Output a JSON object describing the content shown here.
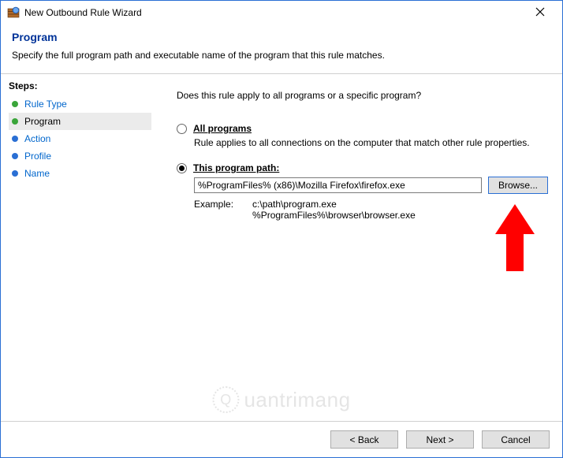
{
  "window": {
    "title": "New Outbound Rule Wizard"
  },
  "header": {
    "title": "Program",
    "subtitle": "Specify the full program path and executable name of the program that this rule matches."
  },
  "sidebar": {
    "title": "Steps:",
    "items": [
      {
        "label": "Rule Type"
      },
      {
        "label": "Program"
      },
      {
        "label": "Action"
      },
      {
        "label": "Profile"
      },
      {
        "label": "Name"
      }
    ]
  },
  "content": {
    "prompt": "Does this rule apply to all programs or a specific program?",
    "all_programs": {
      "label": "All programs",
      "desc": "Rule applies to all connections on the computer that match other rule properties."
    },
    "this_path": {
      "label": "This program path:",
      "value": "%ProgramFiles% (x86)\\Mozilla Firefox\\firefox.exe",
      "browse": "Browse..."
    },
    "example": {
      "label": "Example:",
      "line1": "c:\\path\\program.exe",
      "line2": "%ProgramFiles%\\browser\\browser.exe"
    }
  },
  "footer": {
    "back": "< Back",
    "next": "Next >",
    "cancel": "Cancel"
  },
  "watermark": {
    "text": "uantrimang"
  }
}
